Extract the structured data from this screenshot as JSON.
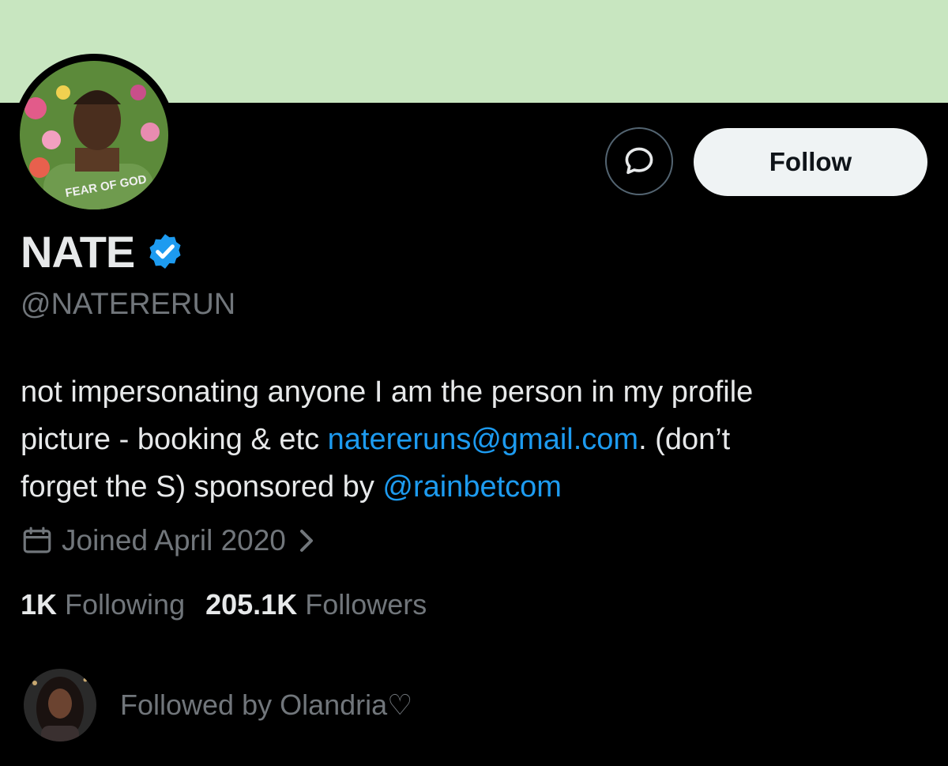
{
  "banner": {
    "color": "#c8e6c0"
  },
  "profile": {
    "avatar_icon": "profile-photo",
    "avatar_shirt_text": "FEAR OF GOD",
    "name": "NATE",
    "verified_icon": "verified-badge-icon",
    "handle": "@NATERERUN",
    "bio": {
      "line1": "not impersonating anyone I am the person in my profile",
      "line2_prefix": "picture - booking & etc ",
      "email": "natereruns@gmail.com",
      "line2_suffix": ". (don’t",
      "line3_prefix": "forget the S) sponsored by ",
      "mention": "@rainbetcom"
    },
    "joined": "Joined April 2020"
  },
  "actions": {
    "message_icon": "message-icon",
    "follow_label": "Follow"
  },
  "stats": {
    "following_count": "1K",
    "following_label": "Following",
    "followers_count": "205.1K",
    "followers_label": "Followers"
  },
  "followed_by": {
    "text": "Followed by Olandria♡"
  },
  "colors": {
    "accent": "#1d9bf0",
    "muted": "#71767b",
    "text": "#e7e9ea",
    "background": "#000000"
  }
}
